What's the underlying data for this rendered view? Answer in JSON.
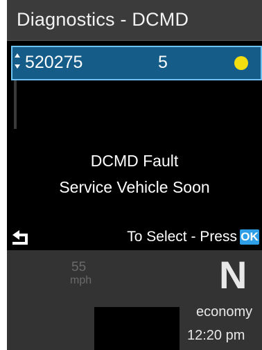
{
  "header": {
    "title": "Diagnostics - DCMD"
  },
  "fault_row": {
    "code": "520275",
    "count": "5",
    "status_color": "#f5de10"
  },
  "message": {
    "line1": "DCMD Fault",
    "line2": "Service Vehicle Soon"
  },
  "footer": {
    "hint": "To Select - Press",
    "ok_label": "OK",
    "back_icon": "back-arrow-icon"
  },
  "cluster": {
    "speed": "55",
    "speed_unit": "mph",
    "gear": "N",
    "mode": "economy",
    "time": "12:20 pm"
  }
}
